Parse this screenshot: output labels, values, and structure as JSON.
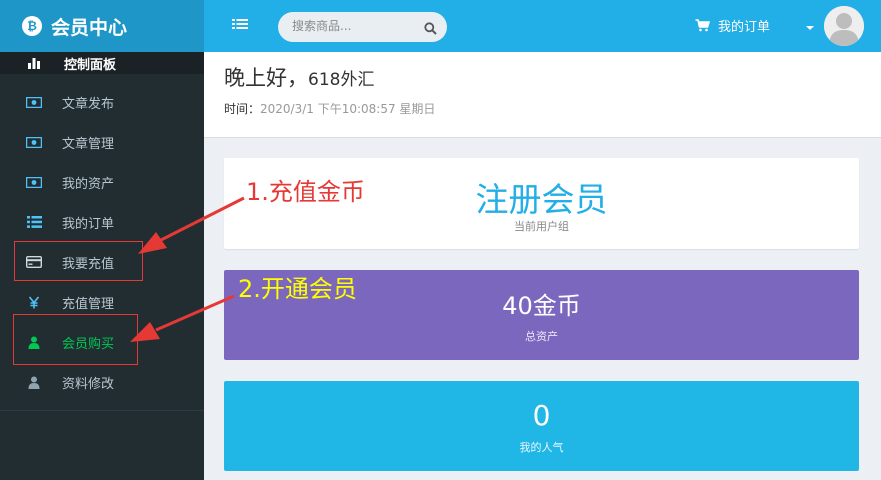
{
  "brand": {
    "logo": "₿",
    "title": "会员中心"
  },
  "sidebar": {
    "active": {
      "label": "控制面板",
      "icon": "bar-chart-icon"
    },
    "items": [
      {
        "label": "文章发布",
        "icon": "money-icon"
      },
      {
        "label": "文章管理",
        "icon": "money-icon"
      },
      {
        "label": "我的资产",
        "icon": "money-icon"
      },
      {
        "label": "我的订单",
        "icon": "list-icon"
      },
      {
        "label": "我要充值",
        "icon": "credit-card-icon"
      },
      {
        "label": "充值管理",
        "icon": "yen-icon"
      },
      {
        "label": "会员购买",
        "icon": "user-icon"
      },
      {
        "label": "资料修改",
        "icon": "user-icon"
      }
    ]
  },
  "header": {
    "search_placeholder": "搜索商品...",
    "orders_label": "我的订单"
  },
  "content": {
    "greeting": "晚上好，",
    "username": "618外汇",
    "time_label": "时间：",
    "time_value": "2020/3/1 下午10:08:57 星期日"
  },
  "cards": [
    {
      "value": "注册会员",
      "label": "当前用户组"
    },
    {
      "value": "40金币",
      "label": "总资产"
    },
    {
      "value": "0",
      "label": "我的人气"
    }
  ],
  "annotations": {
    "step1": "1.充值金币",
    "step2": "2.开通会员",
    "colors": {
      "arrow": "#e53935",
      "step1": "#e53935",
      "step2": "#ffff00"
    }
  },
  "colors": {
    "sidebar": "#222d32",
    "header": "#22aee6",
    "brand": "#1e96c8",
    "purple": "#7b68be",
    "blue": "#20b6e6"
  }
}
